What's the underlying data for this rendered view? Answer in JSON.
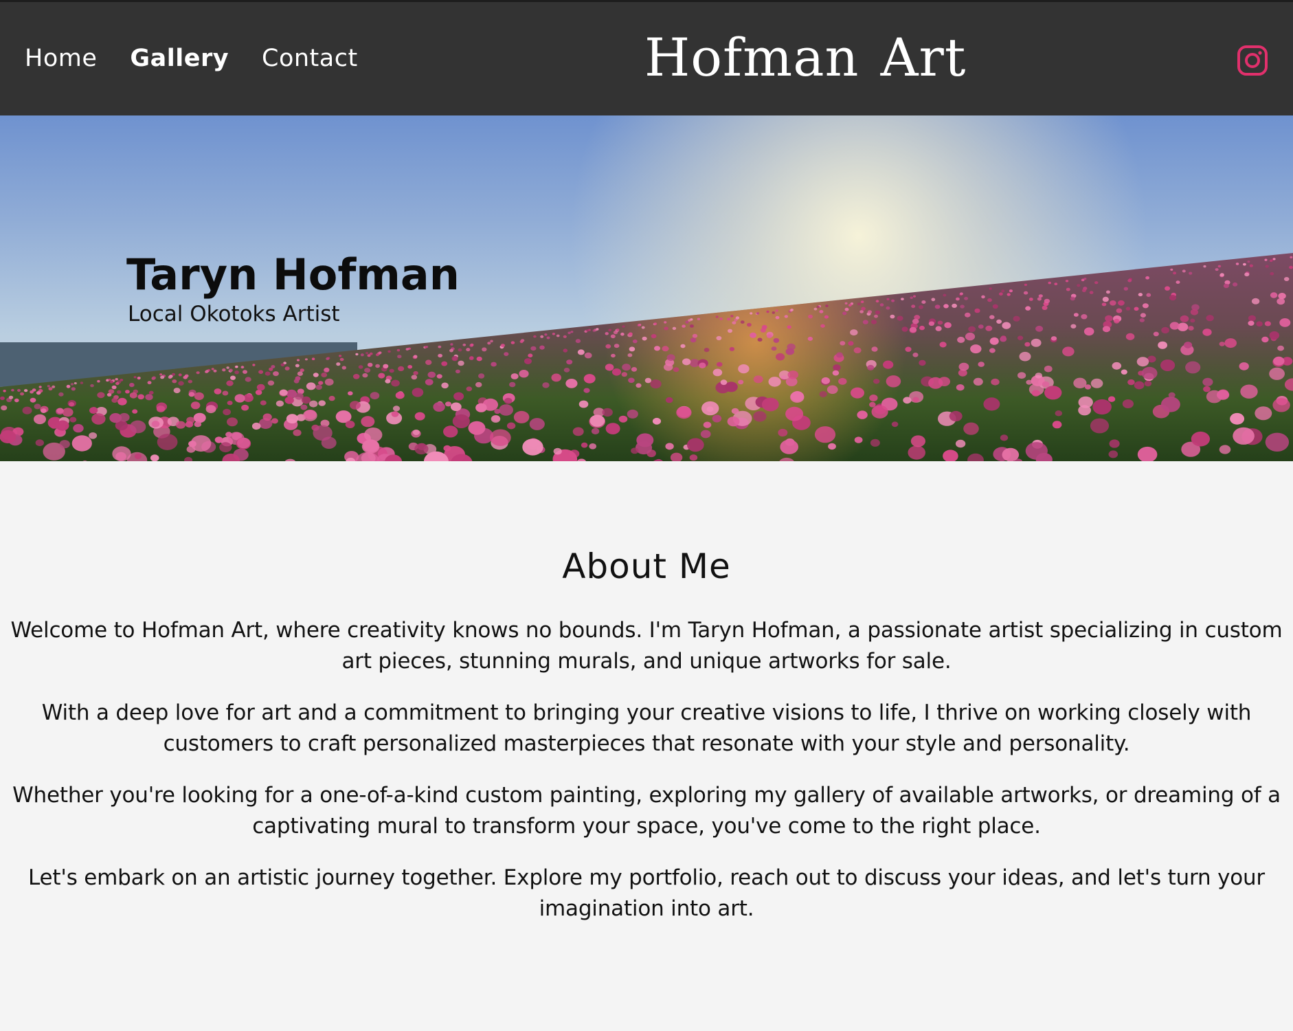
{
  "header": {
    "nav": [
      {
        "label": "Home",
        "active": false
      },
      {
        "label": "Gallery",
        "active": true
      },
      {
        "label": "Contact",
        "active": false
      }
    ],
    "logo": "Hofman Art",
    "social_icon": "instagram-icon",
    "social_color": "#e1306c"
  },
  "hero": {
    "title": "Taryn Hofman",
    "subtitle": "Local Okotoks Artist"
  },
  "about": {
    "heading": "About Me",
    "paragraphs": [
      "Welcome to Hofman Art, where creativity knows no bounds. I'm Taryn Hofman, a passionate artist specializing in custom art pieces, stunning murals, and unique artworks for sale.",
      "With a deep love for art and a commitment to bringing your creative visions to life, I thrive on working closely with customers to craft personalized masterpieces that resonate with your style and personality.",
      "Whether you're looking for a one-of-a-kind custom painting, exploring my gallery of available artworks, or dreaming of a captivating mural to transform your space, you've come to the right place.",
      "Let's embark on an artistic journey together. Explore my portfolio, reach out to discuss your ideas, and let's turn your imagination into art."
    ]
  }
}
